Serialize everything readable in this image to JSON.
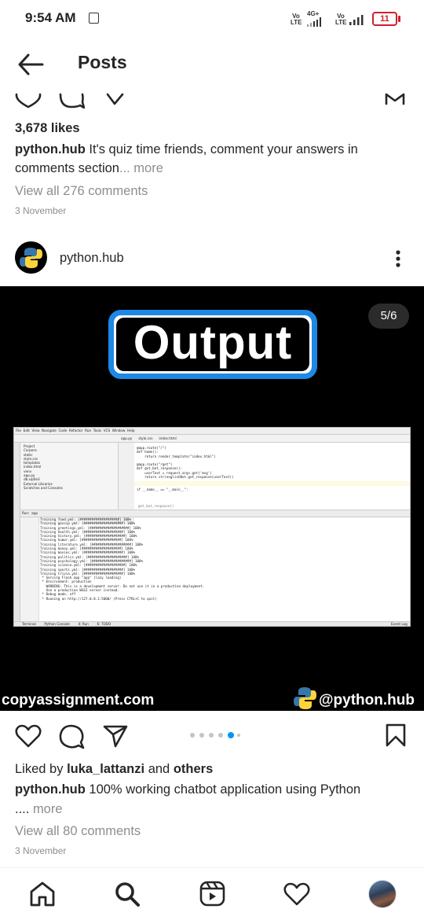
{
  "status_bar": {
    "time": "9:54 AM",
    "sim1_label": "Vo LTE",
    "net_label": "4G+",
    "sim2_label": "Vo LTE",
    "battery": "11"
  },
  "header": {
    "title": "Posts",
    "back_icon": "arrow-left-icon"
  },
  "prev_post": {
    "likes": "3,678 likes",
    "username": "python.hub",
    "caption_line1": "It's quiz time friends, comment your answers in",
    "caption_line2": "comments section",
    "more": "... more",
    "view_comments": "View all 276 comments",
    "date": "3 November"
  },
  "post": {
    "username": "python.hub",
    "menu_icon": "more-vertical-icon",
    "counter": "5/6",
    "image_title": "Output",
    "watermark_left": "copyassignment.com",
    "watermark_right": "@python.hub",
    "carousel": {
      "count": 6,
      "active": 4
    },
    "liked_by_prefix": "Liked by",
    "liked_by_user": "luka_lattanzi",
    "liked_by_and": "and",
    "liked_by_others": "others",
    "caption_user": "python.hub",
    "caption": "100% working chatbot application using Python",
    "caption_more_prefix": "....",
    "caption_more": "more",
    "view_comments": "View all 80 comments",
    "date": "3 November"
  },
  "ide": {
    "menu": [
      "File",
      "Edit",
      "View",
      "Navigate",
      "Code",
      "Refactor",
      "Run",
      "Tools",
      "VCS",
      "Window",
      "Help"
    ],
    "tabs": [
      "app.py",
      "style.css",
      "index.html"
    ],
    "project_tree": [
      "Project",
      "Corpora",
      "static",
      "style.css",
      "templates",
      "index.html",
      "venv",
      "app.py",
      "db.sqlite3",
      "External Libraries",
      "Scratches and Consoles"
    ],
    "code_lines": [
      "@app.route(\"/\")",
      "def home():",
      "    return render_template(\"index.html\")",
      "",
      "@app.route(\"/get\")",
      "def get_bot_response():",
      "    userText = request.args.get('msg')",
      "    return str(englishBot.get_response(userText))",
      "",
      "",
      "if __name__ == \"__main__\":"
    ],
    "breadcrumb": "get_bot_response()",
    "run_tab": "Run:",
    "run_name": "app",
    "console_lines": [
      "Training food.yml: [####################] 100%",
      "Training gossip.yml: [####################] 100%",
      "Training greetings.yml: [####################] 100%",
      "Training health.yml: [####################] 100%",
      "Training history.yml: [####################] 100%",
      "Training humor.yml: [####################] 100%",
      "Training literature.yml: [####################] 100%",
      "Training money.yml: [####################] 100%",
      "Training movies.yml: [####################] 100%",
      "Training politics.yml: [####################] 100%",
      "Training psychology.yml: [####################] 100%",
      "Training science.yml: [####################] 100%",
      "Training sports.yml: [####################] 100%",
      "Training trivia.yml: [####################] 100%",
      " * Serving Flask app \"app\" (lazy loading)",
      " * Environment: production",
      "   WARNING: This is a development server. Do not use it in a production deployment.",
      "   Use a production WSGI server instead.",
      " * Debug mode: off",
      " * Running on http://127.0.0.1:5000/ (Press CTRL+C to quit)"
    ],
    "bottom_tabs": [
      "Terminal",
      "Python Console",
      "4: Run",
      "6: TODO"
    ],
    "event_log": "Event Log"
  },
  "nav": {
    "items": [
      "home-icon",
      "search-icon",
      "reels-icon",
      "activity-heart-icon",
      "profile-avatar"
    ]
  },
  "colors": {
    "text": "#262626",
    "muted": "#8e8e8e",
    "accent_blue": "#1e88e5",
    "battery_red": "#d0202a"
  }
}
